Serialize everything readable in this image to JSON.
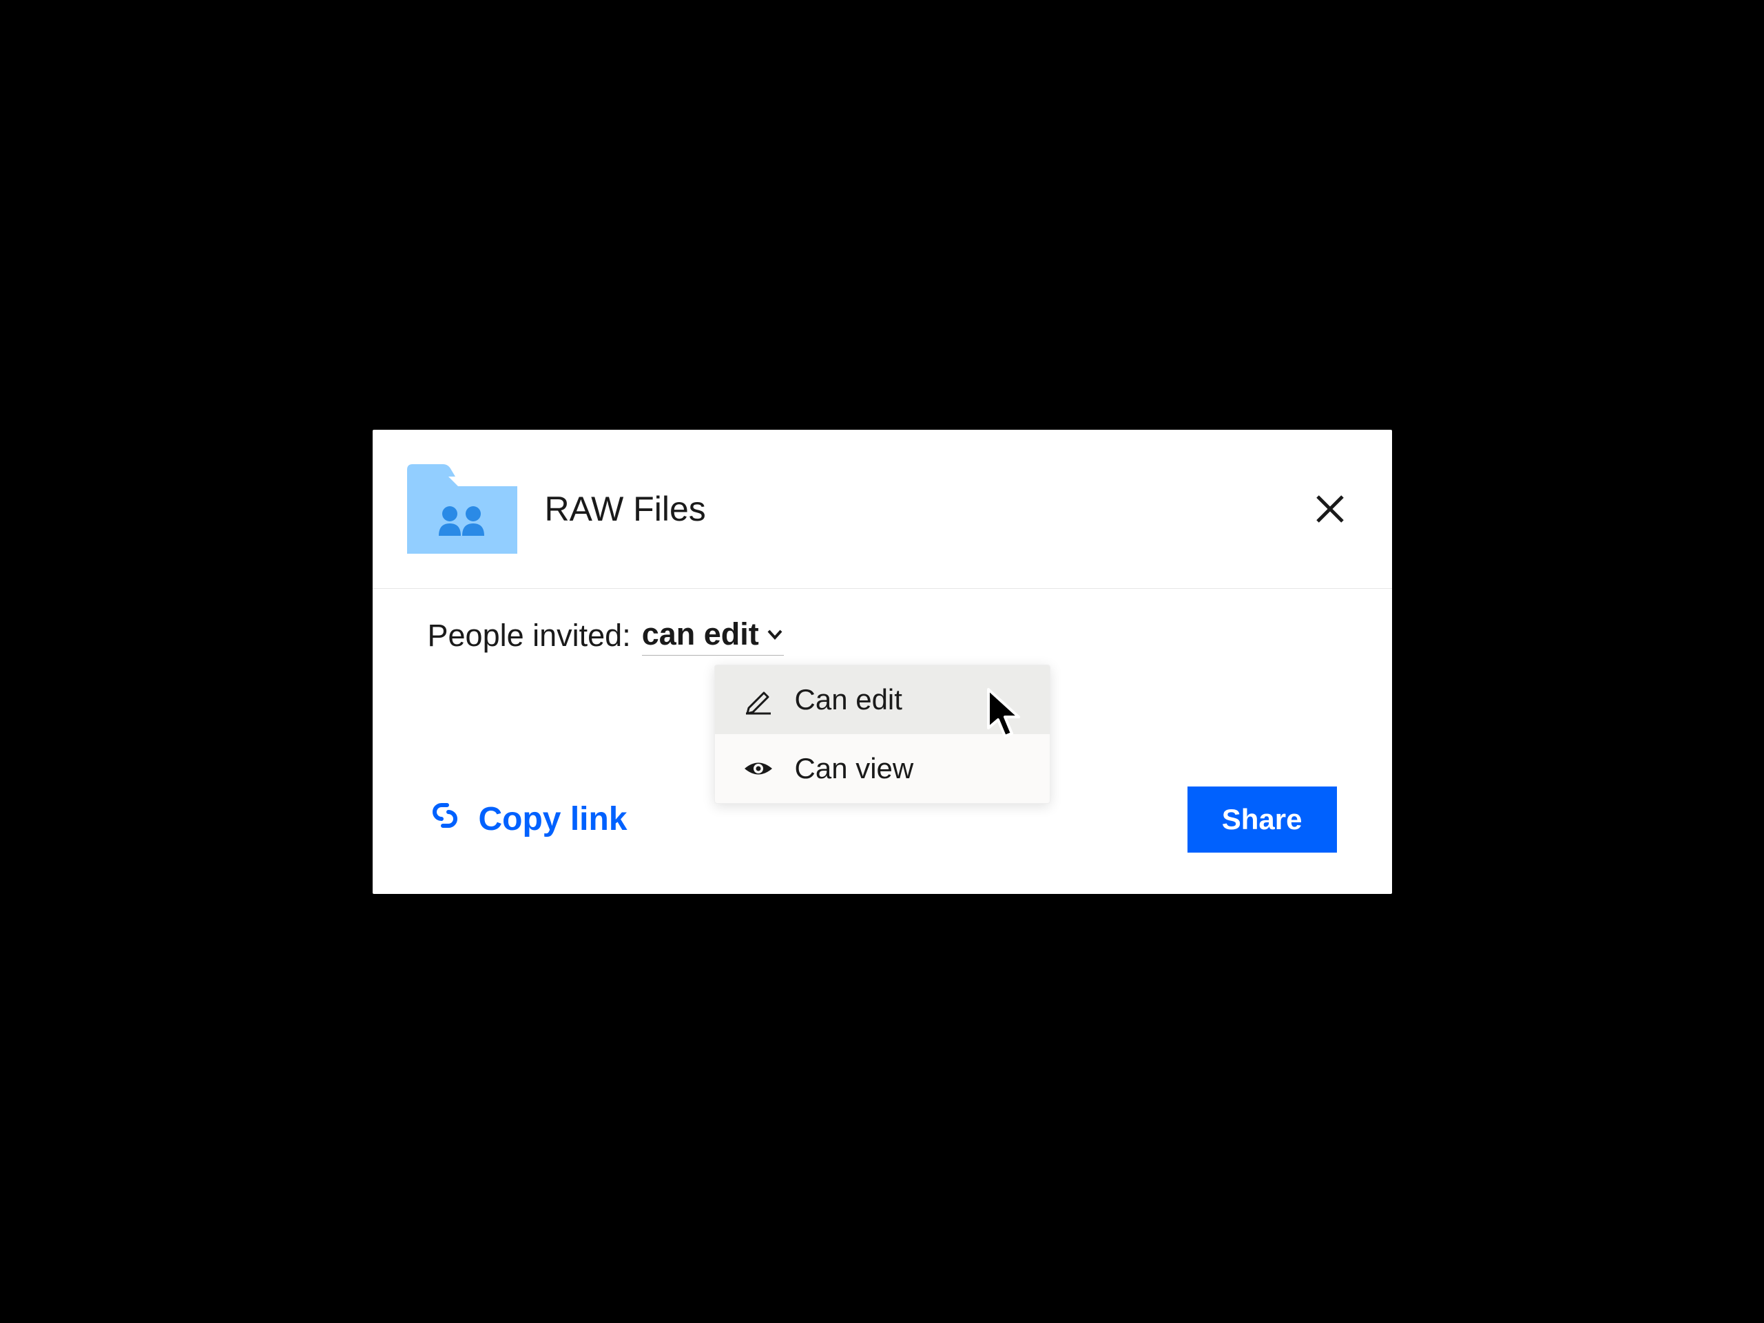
{
  "dialog": {
    "title": "RAW Files",
    "invite_label": "People invited:",
    "permission_selected": "can edit",
    "dropdown": {
      "option_edit": "Can edit",
      "option_view": "Can view"
    },
    "copy_link_label": "Copy link",
    "share_label": "Share"
  },
  "colors": {
    "accent": "#0061fe",
    "folder": "#92ceff"
  }
}
